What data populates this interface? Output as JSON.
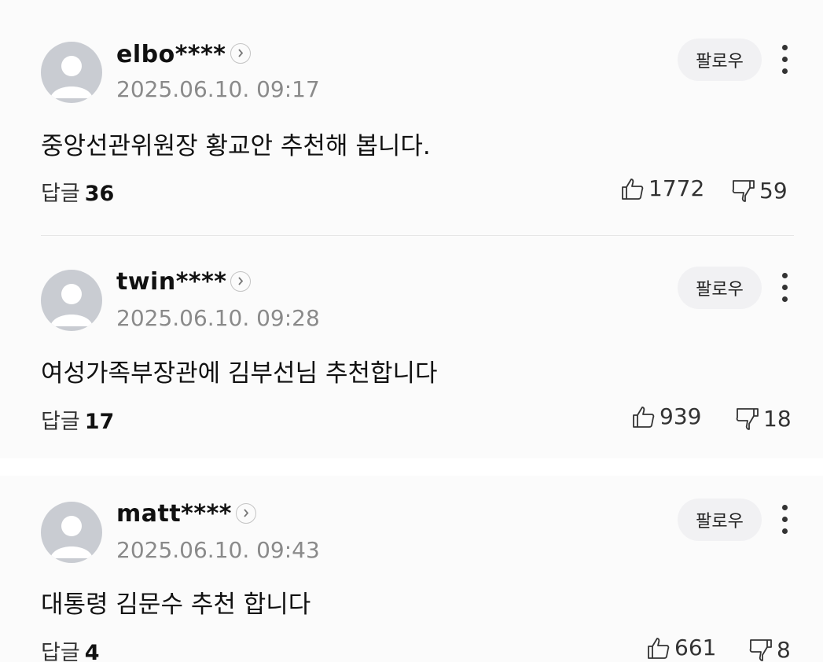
{
  "follow_label": "팔로우",
  "reply_label": "답글",
  "comments": [
    {
      "username": "elbo****",
      "timestamp": "2025.06.10. 09:17",
      "text": "중앙선관위원장 황교안 추천해 봅니다.",
      "replies": "36",
      "likes": "1772",
      "dislikes": "59"
    },
    {
      "username": "twin****",
      "timestamp": "2025.06.10. 09:28",
      "text": "여성가족부장관에 김부선님 추천합니다",
      "replies": "17",
      "likes": "939",
      "dislikes": "18"
    },
    {
      "username": "matt****",
      "timestamp": "2025.06.10. 09:43",
      "text": "대통령 김문수 추천 합니다",
      "replies": "4",
      "likes": "661",
      "dislikes": "8"
    }
  ],
  "colors": {
    "avatar_bg": "#c9ccd2",
    "timestamp": "#8a8a8a",
    "follow_bg": "#f1f1f3",
    "divider": "#e6e6e6"
  },
  "icons": {
    "profile": "chevron-right-icon",
    "like": "thumbs-up-icon",
    "dislike": "thumbs-down-icon",
    "more": "more-vertical-icon"
  }
}
